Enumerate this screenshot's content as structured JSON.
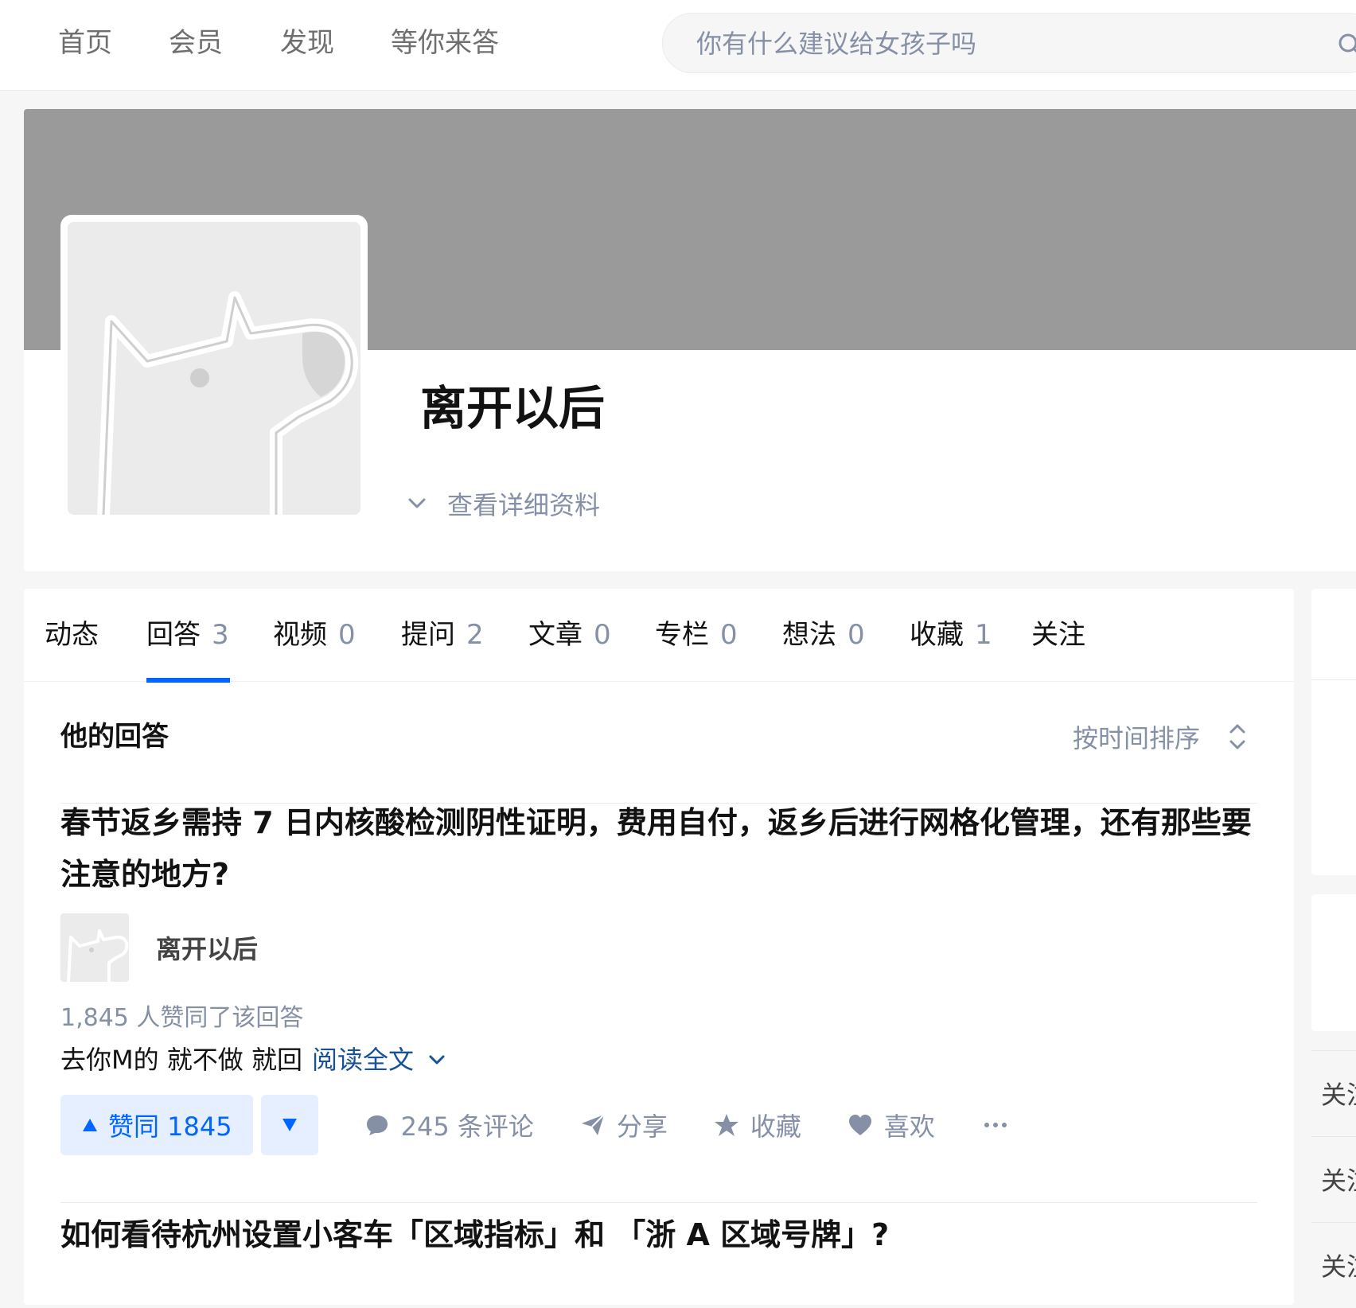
{
  "topbar": {
    "nav": [
      "首页",
      "会员",
      "发现",
      "等你来答"
    ],
    "search_placeholder": "你有什么建议给女孩子吗"
  },
  "profile": {
    "name": "离开以后",
    "detail_link": "查看详细资料"
  },
  "tabs": [
    {
      "label": "动态",
      "count": ""
    },
    {
      "label": "回答",
      "count": "3"
    },
    {
      "label": "视频",
      "count": "0"
    },
    {
      "label": "提问",
      "count": "2"
    },
    {
      "label": "文章",
      "count": "0"
    },
    {
      "label": "专栏",
      "count": "0"
    },
    {
      "label": "想法",
      "count": "0"
    },
    {
      "label": "收藏",
      "count": "1"
    },
    {
      "label": "关注",
      "count": ""
    }
  ],
  "active_tab": "回答",
  "section": {
    "title": "他的回答",
    "sort_label": "按时间排序"
  },
  "answers": [
    {
      "question": "春节返乡需持 7 日内核酸检测阴性证明，费用自付，返乡后进行网格化管理，还有那些要注意的地方?",
      "author": "离开以后",
      "vote_info": "1,845 人赞同了该回答",
      "excerpt": "去你M的 就不做 就回",
      "read_more": "阅读全文",
      "vote_up_label": "赞同 1845",
      "comments": "245 条评论",
      "share": "分享",
      "favorite": "收藏",
      "like": "喜欢"
    },
    {
      "question": "如何看待杭州设置小客车「区域指标」和 「浙 A 区域号牌」?"
    }
  ],
  "side": {
    "links": [
      "关注",
      "关注",
      "关注"
    ]
  },
  "colors": {
    "accent": "#0066ff",
    "accent_bg": "#e5efff",
    "muted": "#8590a6",
    "link": "#175199",
    "cover": "#9a9a9a"
  }
}
